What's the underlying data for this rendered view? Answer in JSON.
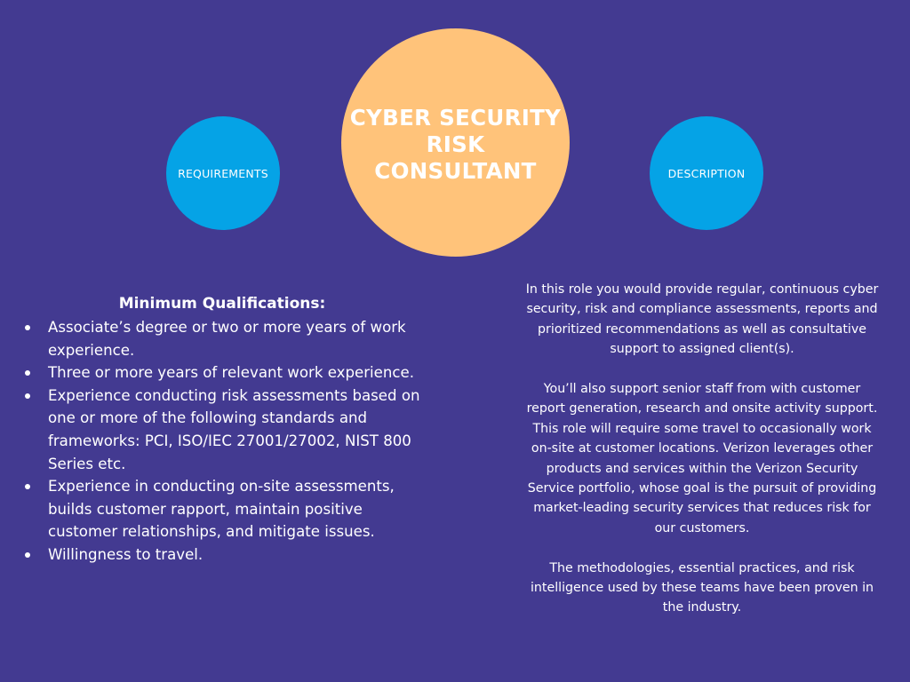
{
  "header": {
    "title": "CYBER SECURITY RISK CONSULTANT",
    "requirements_label": "REQUIREMENTS",
    "description_label": "DESCRIPTION"
  },
  "colors": {
    "background": "#433a91",
    "title_circle": "#ffc37a",
    "side_circles": "#05a3e6",
    "text": "#ffffff"
  },
  "requirements": {
    "heading": "Minimum Qualifications:",
    "items": [
      "Associate’s degree or two or more years of work experience.",
      "Three or more years of relevant work experience.",
      "Experience conducting risk assessments based on one or more of the following standards and frameworks: PCI, ISO/IEC 27001/27002, NIST 800 Series etc.",
      "Experience in conducting on-site assessments, builds customer rapport, maintain positive customer relationships, and mitigate issues.",
      "Willingness to travel."
    ]
  },
  "description": {
    "paragraphs": [
      "In this role you would provide regular, continuous cyber security, risk and compliance assessments, reports and prioritized recommendations as well as consultative support to assigned client(s).",
      "You’ll also support senior staff from with customer report generation, research and onsite activity support. This role will require some travel to occasionally work on-site at customer locations. Verizon leverages other products and services within the Verizon Security Service portfolio, whose goal is the pursuit of providing market-leading security services that reduces risk for our customers.",
      "The methodologies, essential practices, and risk intelligence used by these teams have been proven in the industry."
    ]
  }
}
